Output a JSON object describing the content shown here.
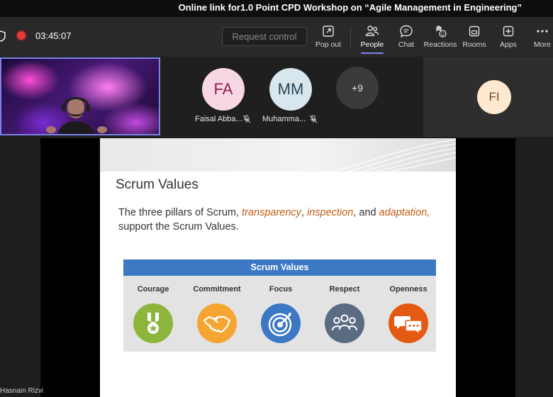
{
  "window": {
    "title": "Online link for1.0 Point CPD Workshop on “Agile Management in Engineering”"
  },
  "toolbar": {
    "timer": "03:45:07",
    "request_control": "Request control",
    "buttons": [
      {
        "label": "Pop out",
        "icon": "pop-out-icon"
      },
      {
        "label": "People",
        "icon": "people-icon",
        "active": true
      },
      {
        "label": "Chat",
        "icon": "chat-icon"
      },
      {
        "label": "Reactions",
        "icon": "reactions-icon"
      },
      {
        "label": "Rooms",
        "icon": "rooms-icon"
      },
      {
        "label": "Apps",
        "icon": "apps-icon"
      },
      {
        "label": "More",
        "icon": "more-icon"
      }
    ]
  },
  "participants": [
    {
      "initials": "FA",
      "name": "Faisal Abba...",
      "muted": true
    },
    {
      "initials": "MM",
      "name": "Muhamma...",
      "muted": true
    },
    {
      "initials": "+9"
    },
    {
      "initials": "FI"
    }
  ],
  "presenter_name": "Hasnain Rizvi",
  "slide": {
    "title": "Scrum Values",
    "body_prefix": "The three pillars of Scrum, ",
    "term1": "transparency",
    "sep1": ", ",
    "term2": "inspection",
    "sep2": ", and ",
    "term3": "adaptation,",
    "body_suffix": " support the Scrum Values.",
    "panel_title": "Scrum Values",
    "values": [
      {
        "label": "Courage",
        "icon": "medal-icon",
        "color": "#8db53c"
      },
      {
        "label": "Commitment",
        "icon": "handshake-icon",
        "color": "#f5a531"
      },
      {
        "label": "Focus",
        "icon": "target-icon",
        "color": "#3c78c3"
      },
      {
        "label": "Respect",
        "icon": "group-icon",
        "color": "#5b6b82"
      },
      {
        "label": "Openness",
        "icon": "speech-bubbles-icon",
        "color": "#e55a12"
      }
    ]
  },
  "colors": {
    "accent": "#7b83eb",
    "record": "#e23b3b",
    "highlight": "#c55a11",
    "panel_header": "#3c78c3"
  }
}
